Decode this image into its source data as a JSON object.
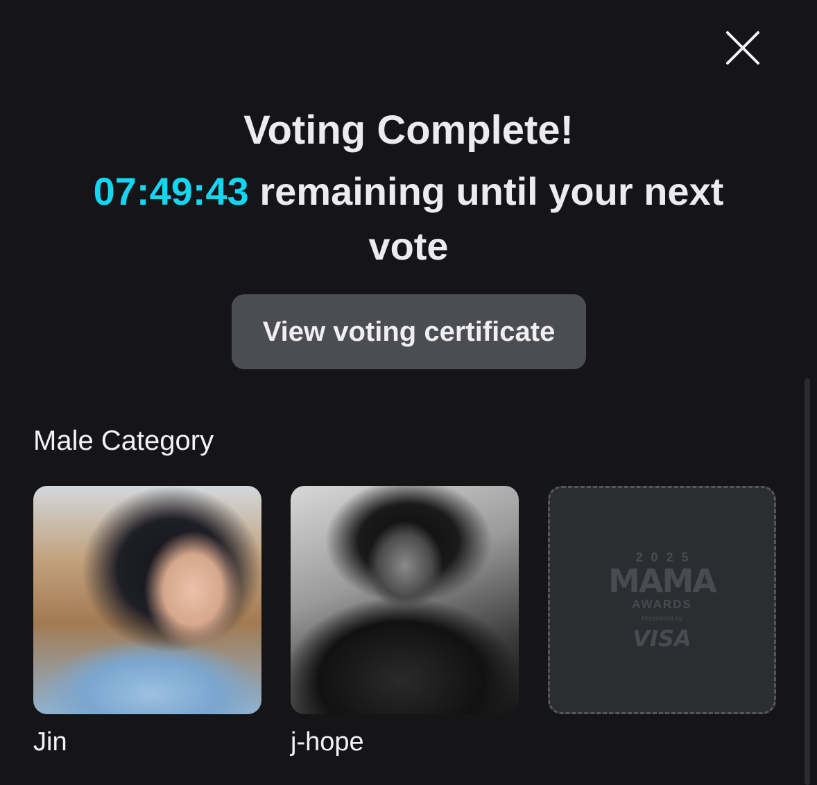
{
  "modal": {
    "title": "Voting Complete!",
    "countdown": "07:49:43",
    "countdown_suffix": " remaining until your next vote",
    "countdown_color": "#14d6f0",
    "close_icon": "close-icon"
  },
  "actions": {
    "view_certificate_label": "View voting certificate"
  },
  "category": {
    "title": "Male Category",
    "selections": [
      {
        "name": "Jin"
      },
      {
        "name": "j-hope"
      }
    ],
    "placeholder": {
      "year": "2025",
      "logo": "MAMA",
      "awards": "AWARDS",
      "presented": "Presented by",
      "sponsor": "VISA"
    }
  }
}
